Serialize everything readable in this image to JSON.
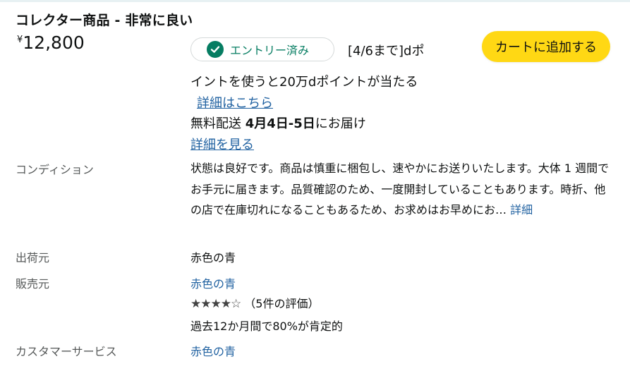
{
  "offer": {
    "title": "コレクター商品 - 非常に良い",
    "price_symbol": "¥",
    "price_amount": "12,800"
  },
  "promo": {
    "entry_status": "エントリー済み",
    "line1": "[4/6まで]dポ",
    "line2": "イントを使うと20万dポイントが当たる",
    "detail_link": "詳細はこちら"
  },
  "cart": {
    "button_label": "カートに追加する"
  },
  "delivery": {
    "prefix": "無料配送 ",
    "date": "4月4日-5日",
    "suffix": "にお届け",
    "details_link": "詳細を見る"
  },
  "condition": {
    "label": "コンディション",
    "text": "状態は良好です。商品は慎重に梱包し、速やかにお送りいたします。大体 1 週間でお手元に届きます。品質確認のため、一度開封していることもあります。時折、他の店で在庫切れになることもあるため、お求めはお早めにお… ",
    "more_link": "詳細"
  },
  "ships_from": {
    "label": "出荷元",
    "value": "赤色の青"
  },
  "sold_by": {
    "label": "販売元",
    "value": "赤色の青",
    "stars": "★★★★☆",
    "rating_value": 4,
    "review_count": "（5件の評価）",
    "positive": "過去12か月間で80%が肯定的"
  },
  "customer_service": {
    "label": "カスタマーサービス",
    "value": "赤色の青"
  },
  "colors": {
    "accent_green": "#067d62",
    "link_blue": "#2162a1",
    "cart_yellow": "#ffd814",
    "label_gray": "#565959"
  },
  "icons": {
    "entry_check": "check-circle-icon",
    "rating": "star-icon"
  }
}
